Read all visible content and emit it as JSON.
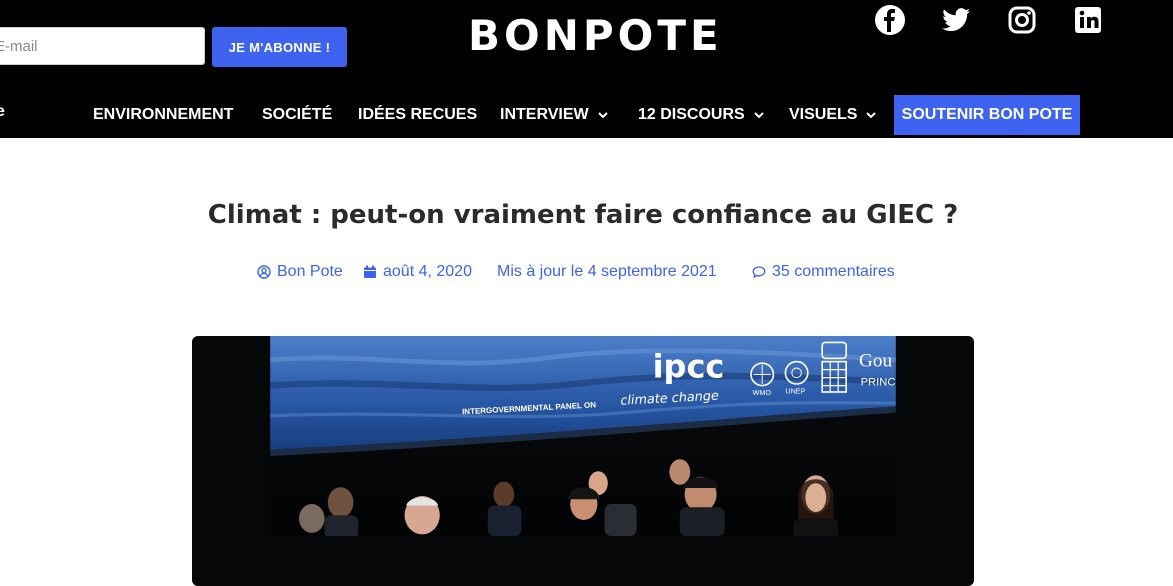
{
  "header": {
    "email_placeholder": "E-mail",
    "subscribe_label": "JE M'ABONNE !",
    "brand": "BONPOTE",
    "social": [
      "facebook-icon",
      "twitter-icon",
      "instagram-icon",
      "linkedin-icon"
    ]
  },
  "nav": {
    "cut_item": "e",
    "items": [
      {
        "label": "ENVIRONNEMENT",
        "dropdown": false
      },
      {
        "label": "SOCIÉTÉ",
        "dropdown": false
      },
      {
        "label": "IDÉES RECUES",
        "dropdown": false
      },
      {
        "label": "INTERVIEW",
        "dropdown": true
      },
      {
        "label": "12 DISCOURS",
        "dropdown": true
      },
      {
        "label": "VISUELS",
        "dropdown": true
      }
    ],
    "cta": "SOUTENIR BON POTE"
  },
  "article": {
    "title": "Climat : peut-on vraiment faire confiance au GIEC ?",
    "author": "Bon Pote",
    "date": "août 4, 2020",
    "updated": "Mis à jour le 4 septembre 2021",
    "comments": "35 commentaires"
  },
  "hero_image": {
    "logo": "ipcc",
    "panel_text": "INTERGOVERNMENTAL PANEL ON",
    "panel_script": "climate change",
    "org1": "WMO",
    "org2": "UNEP",
    "partner_fragment": "Gou",
    "partner_fragment2": "PRINC"
  },
  "colors": {
    "accent": "#3d63f0",
    "header_bg": "#000000",
    "title": "#2b2b2b"
  }
}
